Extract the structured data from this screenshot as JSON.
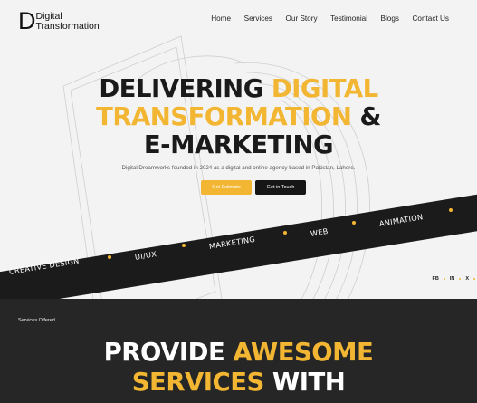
{
  "brand": {
    "mark": "D",
    "line1": "Digital",
    "line2": "Transformation"
  },
  "nav": {
    "items": [
      {
        "label": "Home"
      },
      {
        "label": "Services"
      },
      {
        "label": "Our Story"
      },
      {
        "label": "Testimonial"
      },
      {
        "label": "Blogs"
      },
      {
        "label": "Contact Us"
      }
    ]
  },
  "hero": {
    "line1_dark": "DELIVERING ",
    "line1_yellow": "DIGITAL",
    "line2_yellow": "TRANSFORMATION",
    "line2_dark": " &",
    "line3_dark": "E-MARKETING",
    "subtitle": "Digital Dreamworks founded in 2024 as a digital and online agency based in Pakistan, Lahore.",
    "btn_estimate": "Get Estimate",
    "btn_touch": "Get in Touch"
  },
  "band": {
    "items": [
      "CREATIVE DESIGN",
      "UI/UX",
      "MARKETING",
      "WEB",
      "ANIMATION"
    ]
  },
  "socials": {
    "fb": "FB",
    "in": "IN",
    "x": "X"
  },
  "services": {
    "label": "Services Offered",
    "title_dark1": "PROVIDE ",
    "title_yellow1": "AWESOME",
    "title_yellow2": "SERVICES",
    "title_dark2": " WITH"
  },
  "colors": {
    "accent": "#f2b632",
    "dark": "#1b1b1b",
    "section_dark": "#262626"
  }
}
